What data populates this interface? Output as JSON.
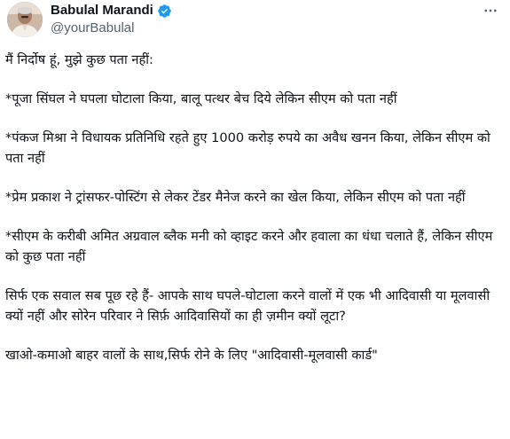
{
  "author": {
    "display_name": "Babulal Marandi",
    "handle": "@yourBabulal",
    "verified": true,
    "avatar_icon": "profile-photo",
    "verified_icon": "verified-badge-icon",
    "more_icon": "more-options-icon"
  },
  "colors": {
    "text": "#0f1419",
    "secondary": "#536471",
    "verified_blue": "#1d9bf0",
    "background": "#ffffff"
  },
  "tweet": {
    "paragraphs": [
      "मैं निर्दोष हूं, मुझे कुछ पता नहीं:",
      "*पूजा सिंघल ने घपला घोटाला किया, बालू पत्थर बेच दिये लेकिन सीएम को पता नहीं",
      "*पंकज मिश्रा ने विधायक प्रतिनिधि रहते हुए 1000 करोड़ रुपये का अवैध खनन किया, लेकिन सीएम को पता नहीं",
      "*प्रेम प्रकाश ने ट्रांसफर-पोस्टिंग से लेकर टेंडर मैनेज करने का खेल किया, लेकिन सीएम को पता नहीं",
      "*सीएम के करीबी अमित अग्रवाल ब्लैक मनी को व्हाइट करने और हवाला का धंधा चलाते हैं, लेकिन सीएम को कुछ पता नहीं",
      "सिर्फ एक सवाल सब पूछ रहे हैं- आपके साथ घपले-घोटाला करने वालों में एक भी आदिवासी या मूलवासी क्यों नहीं और सोरेन परिवार ने सिर्फ़ आदिवासियों का ही ज़मीन क्यों लूटा?",
      "खाओ-कमाओ बाहर वालों के साथ,सिर्फ रोने के लिए \"आदिवासी-मूलवासी कार्ड\""
    ]
  }
}
